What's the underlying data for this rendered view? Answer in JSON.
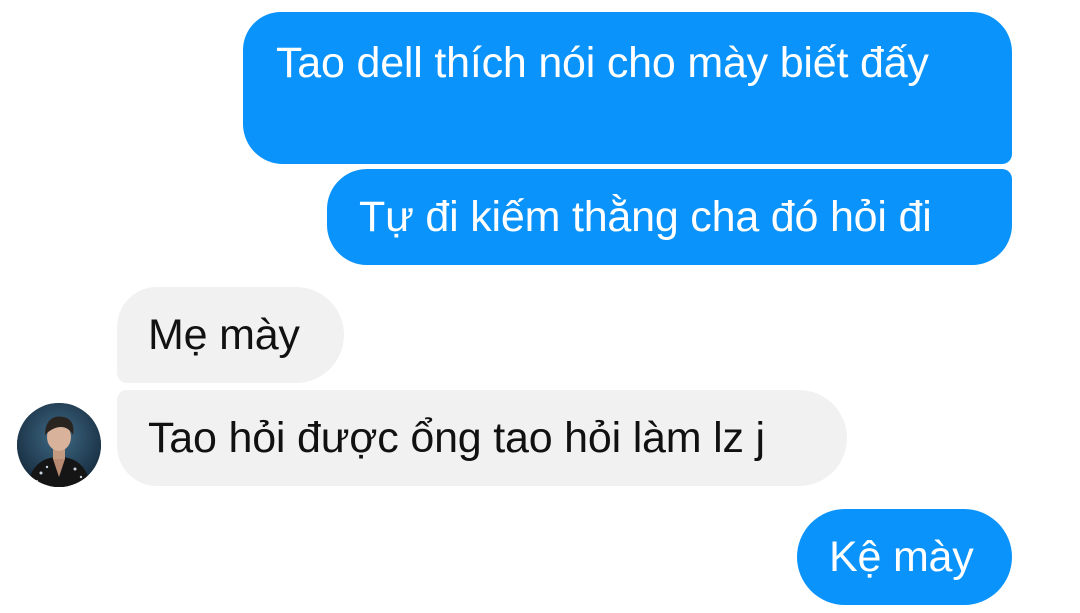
{
  "conversation": {
    "messages": [
      {
        "direction": "outgoing",
        "text": "Tao dell thích nói cho mày biết đấy"
      },
      {
        "direction": "outgoing",
        "text": "Tự đi kiếm thằng cha đó hỏi đi"
      },
      {
        "direction": "incoming",
        "text": "Mẹ mày"
      },
      {
        "direction": "incoming",
        "text": "Tao hỏi được ổng tao hỏi làm lz j"
      },
      {
        "direction": "outgoing",
        "text": "Kệ mày"
      }
    ]
  },
  "colors": {
    "outgoing_bubble": "#0a93fb",
    "incoming_bubble": "#f1f1f1",
    "background": "#ffffff"
  },
  "icons": {
    "contact_avatar": "contact-avatar-photo"
  }
}
